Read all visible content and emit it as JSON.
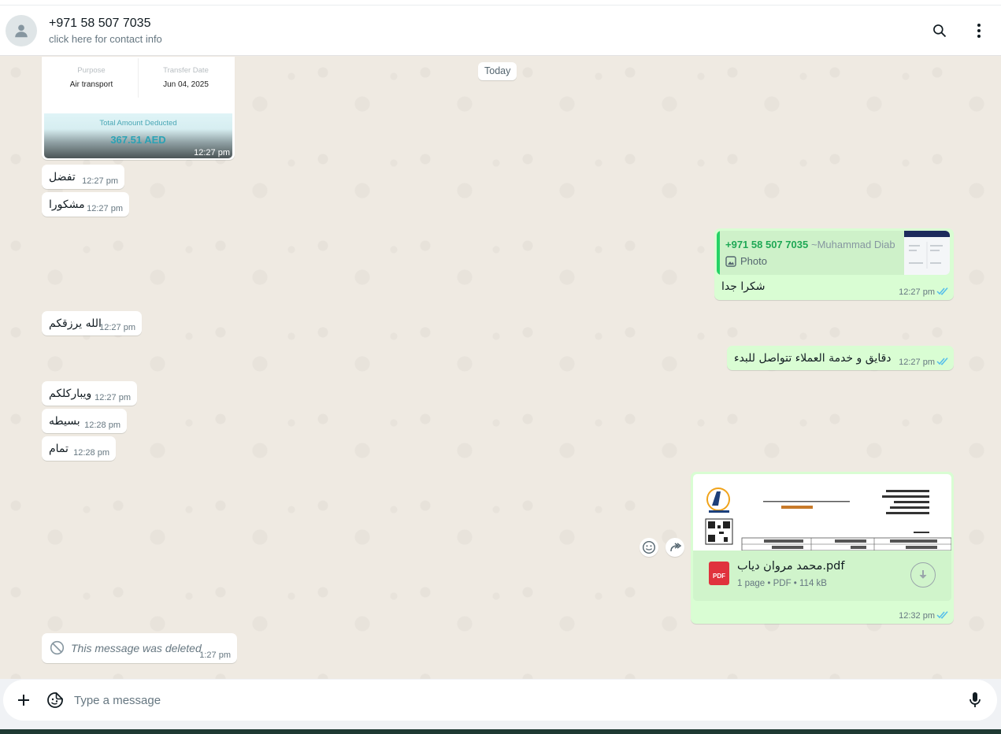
{
  "header": {
    "title": "+971 58 507 7035",
    "subtitle": "click here for contact info",
    "icons": [
      "avatar-icon",
      "search-icon",
      "menu-icon"
    ]
  },
  "chat": {
    "day_divider": "Today",
    "receipt": {
      "purpose_label": "Purpose",
      "purpose_value": "Air transport",
      "date_label": "Transfer Date",
      "date_value": "Jun 04, 2025",
      "total_label": "Total Amount Deducted",
      "total_value": "367.51 AED",
      "time": "12:27 pm"
    },
    "messages": [
      {
        "dir": "in",
        "text": "تفضل",
        "time": "12:27 pm"
      },
      {
        "dir": "in",
        "text": "مشكورا",
        "time": "12:27 pm"
      },
      {
        "dir": "out",
        "text": "شكرا جدا",
        "time": "12:27 pm",
        "reply": {
          "name": "+971 58 507 7035",
          "alias": "~Muhammad Diab",
          "type": "Photo"
        }
      },
      {
        "dir": "in",
        "text": "الله يرزقكم",
        "time": "12:27 pm"
      },
      {
        "dir": "out",
        "text": "دقايق و خدمة العملاء تتواصل للبدء",
        "time": "12:27 pm"
      },
      {
        "dir": "in",
        "text": "ويباركلكم",
        "time": "12:27 pm"
      },
      {
        "dir": "in",
        "text": "بسيطه",
        "time": "12:28 pm"
      },
      {
        "dir": "in",
        "text": "تمام",
        "time": "12:28 pm"
      },
      {
        "dir": "out",
        "type": "document",
        "file_name": "محمد مروان دياب.pdf",
        "meta": "1 page • PDF • 114 kB",
        "badge": "PDF",
        "time": "12:32 pm"
      },
      {
        "dir": "in",
        "type": "deleted",
        "text": "This message was deleted",
        "time": "1:27 pm"
      }
    ]
  },
  "composer": {
    "placeholder": "Type a message",
    "icons": [
      "plus-icon",
      "sticker-icon",
      "mic-icon"
    ]
  },
  "colors": {
    "chat_bg": "#efeae2",
    "incoming": "#ffffff",
    "outgoing": "#d9fdd3",
    "read_tick": "#53bdeb",
    "accent_green": "#25d366"
  }
}
